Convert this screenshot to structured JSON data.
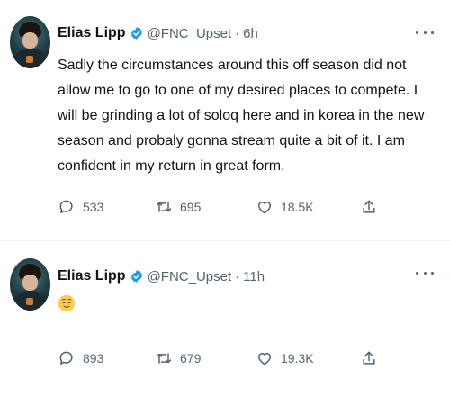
{
  "tweets": [
    {
      "name": "Elias Lipp",
      "handle": "@FNC_Upset",
      "separator": "·",
      "time": "6h",
      "text": "Sadly the circumstances around this off season did not allow me to go to one of my desired places to compete. I will be grinding a lot of soloq here and in korea in the new season and probaly gonna stream quite a bit of it. I am confident in my return in great form.",
      "replies": "533",
      "retweets": "695",
      "likes": "18.5K"
    },
    {
      "name": "Elias Lipp",
      "handle": "@FNC_Upset",
      "separator": "·",
      "time": "11h",
      "emoji": "relieved-face-emoji",
      "replies": "893",
      "retweets": "679",
      "likes": "19.3K"
    }
  ],
  "icons": {
    "verified": "verified-badge-icon",
    "more": "more-options-icon",
    "reply": "reply-icon",
    "retweet": "retweet-icon",
    "like": "heart-icon",
    "share": "share-icon"
  },
  "colors": {
    "verified": "#1d9bf0",
    "secondary_text": "#536471",
    "primary_text": "#0f1419",
    "emoji": "#ffcc4d"
  }
}
